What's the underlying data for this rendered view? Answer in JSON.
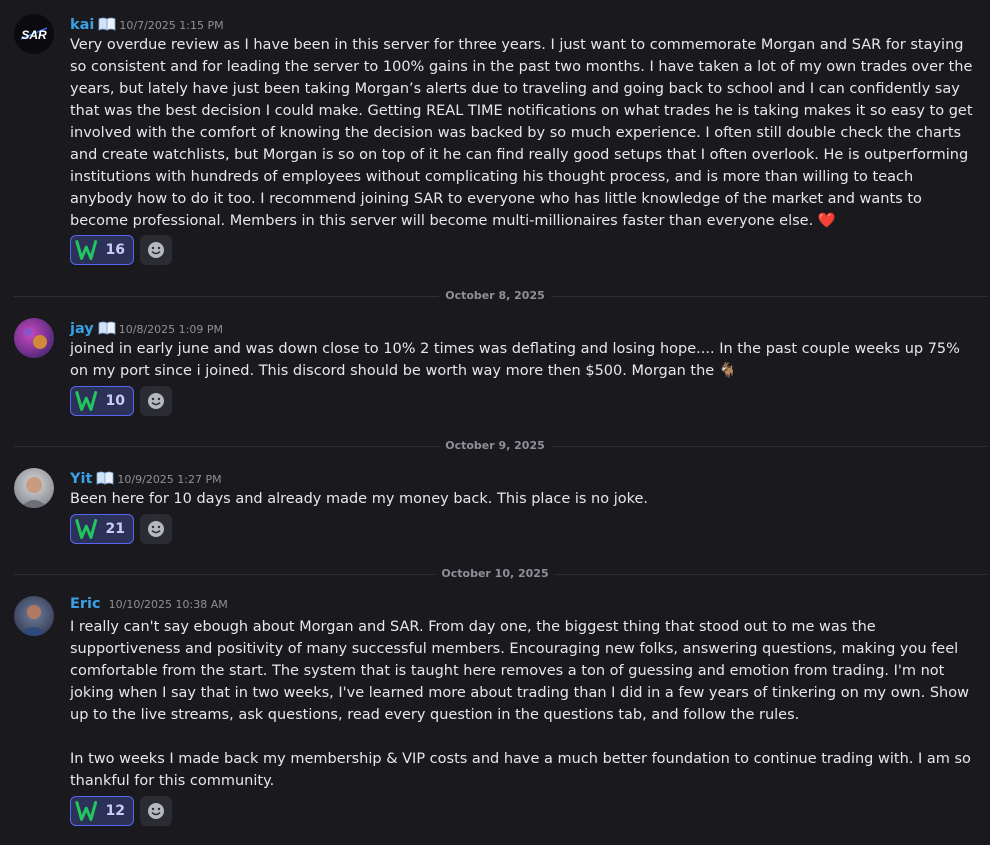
{
  "messages": [
    {
      "username": "kai",
      "timestamp": "10/7/2025 1:15 PM",
      "avatar_text": "SAR",
      "paragraphs": [
        "Very overdue review as I have been in this server for three years. I just want to commemorate Morgan and SAR for staying so consistent and for leading the server to 100% gains in the past two months. I have taken a lot of my own trades over the years, but lately have just been taking Morgan’s alerts due to traveling and going back to school and I can confidently say that was the best decision I could make. Getting REAL TIME notifications on what trades he is taking makes it so easy to get involved with the comfort of knowing the decision was backed by so much experience. I often still double check the charts and create watchlists, but Morgan is so on top of it he can find really good setups that I often overlook. He is outperforming institutions with hundreds of employees without complicating his thought process, and is more than willing to teach anybody how to do it too. I recommend joining SAR to everyone who has little knowledge of the market and wants to become professional. Members in this server will become multi-millionaires faster than everyone else."
      ],
      "emoji": "❤️",
      "reaction": {
        "icon": "w-emoji",
        "count": "16"
      }
    },
    {
      "username": "jay",
      "timestamp": "10/8/2025 1:09 PM",
      "paragraphs": [
        "joined in early june and was down close to 10% 2 times was deflating and losing hope.... In the past couple weeks up 75% on my port since i joined. This discord should be worth way more then $500. Morgan the"
      ],
      "emoji": "🐐",
      "reaction": {
        "icon": "w-emoji",
        "count": "10"
      }
    },
    {
      "username": "Yit",
      "timestamp": "10/9/2025 1:27 PM",
      "paragraphs": [
        "Been here for 10 days and already made my money back. This place is no joke."
      ],
      "reaction": {
        "icon": "w-emoji",
        "count": "21"
      }
    },
    {
      "username": "Eric",
      "timestamp": "10/10/2025 10:38 AM",
      "paragraphs": [
        "I really can't say ebough about Morgan and SAR. From day one, the biggest thing that stood out to me was the supportiveness and positivity of many successful members. Encouraging new folks, answering questions, making you feel comfortable from the start. The system that is taught here removes a ton of guessing and emotion from trading. I'm not joking when I say that in two weeks, I've learned more about trading than I did in a few years of tinkering on my own. Show up to the live streams, ask questions, read every question in the questions tab, and follow the rules.",
        "In two weeks I made back my membership & VIP costs and have a much better foundation to continue trading with. I am so thankful for this community."
      ],
      "reaction": {
        "icon": "w-emoji",
        "count": "12"
      }
    }
  ],
  "dividers": [
    "October 8, 2025",
    "October 9, 2025",
    "October 10, 2025"
  ],
  "colors": {
    "username": "#3aa0e6",
    "reaction_border": "#5865f2",
    "background": "#1a1a1e"
  }
}
